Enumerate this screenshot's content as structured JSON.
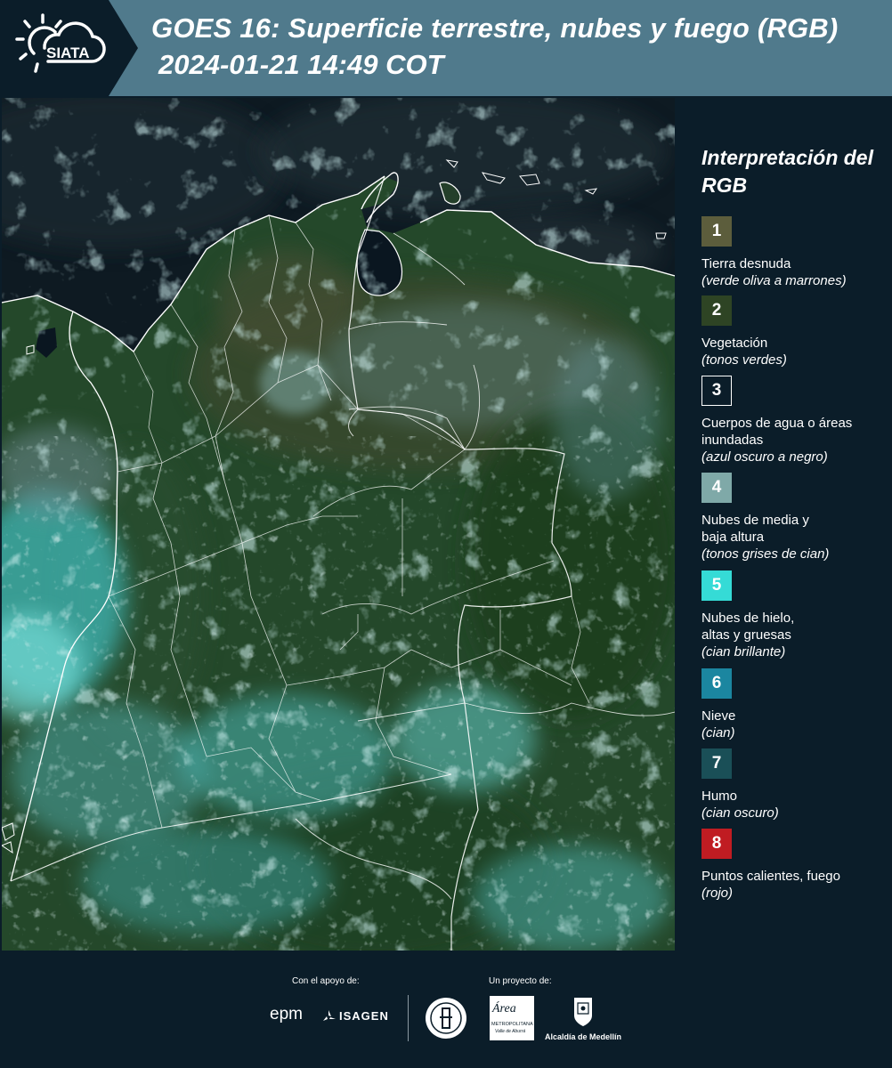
{
  "header": {
    "logo_text": "SIATA",
    "title": "GOES 16: Superficie terrestre, nubes y fuego (RGB)",
    "datetime": "2024-01-21 14:49 COT"
  },
  "legend": {
    "title": "Interpretación del RGB",
    "items": [
      {
        "number": "1",
        "label": "Tierra desnuda",
        "description": "(verde oliva a marrones)",
        "color": "#5c5d3c"
      },
      {
        "number": "2",
        "label": "Vegetación",
        "description": "(tonos verdes)",
        "color": "#2e4424"
      },
      {
        "number": "3",
        "label": "Cuerpos de agua o áreas inundadas",
        "description": "(azul oscuro a negro)",
        "color": "#0b1d29"
      },
      {
        "number": "4",
        "label": "Nubes de media y baja altura",
        "description": "(tonos grises de cian)",
        "color": "#7fa9a8"
      },
      {
        "number": "5",
        "label": "Nubes de hielo, altas y gruesas",
        "description": "(cian brillante)",
        "color": "#35dbd6"
      },
      {
        "number": "6",
        "label": "Nieve",
        "description": "(cian)",
        "color": "#1b86a0"
      },
      {
        "number": "7",
        "label": "Humo",
        "description": "(cian oscuro)",
        "color": "#1a4f57"
      },
      {
        "number": "8",
        "label": "Puntos calientes, fuego",
        "description": "(rojo)",
        "color": "#c01c22"
      }
    ]
  },
  "footer": {
    "support_caption": "Con el apoyo de:",
    "project_caption": "Un proyecto de:",
    "sponsors": [
      "epm",
      "ISAGEN"
    ],
    "partners": [
      "Área Metropolitana Valle de Aburrá",
      "Alcaldía de Medellín"
    ],
    "epm_text": "epm",
    "isagen_text": "ISAGEN",
    "area_text": "Área",
    "area_sub": "METROPOLITANA",
    "area_sub2": "Valle de Aburrá",
    "medellin_text": "Alcaldía de Medellín"
  }
}
